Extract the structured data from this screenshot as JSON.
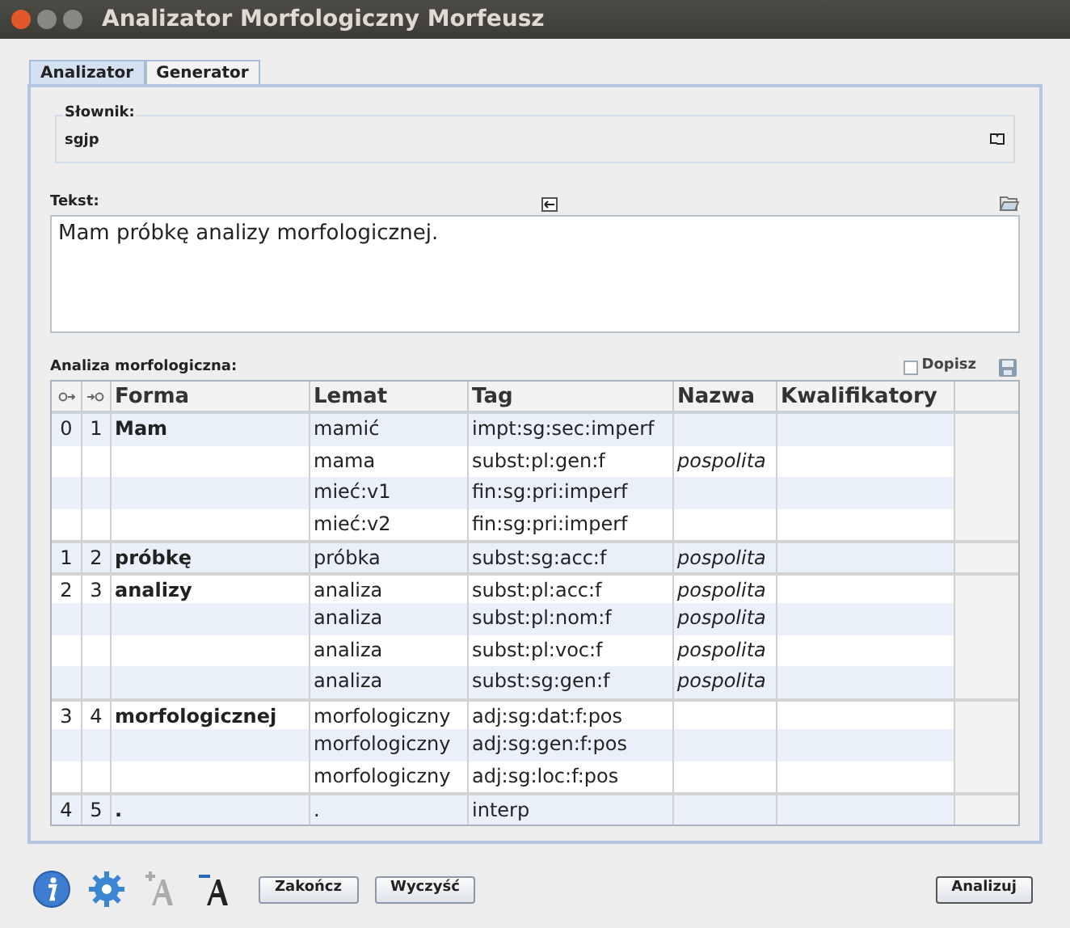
{
  "window": {
    "title": "Analizator Morfologiczny Morfeusz"
  },
  "tabs": [
    {
      "label": "Analizator",
      "selected": true
    },
    {
      "label": "Generator",
      "selected": false
    }
  ],
  "dictionary": {
    "label": "Słownik:",
    "value": "sgjp"
  },
  "text": {
    "label": "Tekst:",
    "value": "Mam próbkę analizy morfologicznej."
  },
  "analysis": {
    "label": "Analiza morfologiczna:",
    "append": {
      "label": "Dopisz",
      "checked": false
    },
    "table": {
      "columns": [
        "Forma",
        "Lemat",
        "Tag",
        "Nazwa",
        "Kwalifikatory"
      ],
      "rows": [
        {
          "start": "0",
          "end": "1",
          "form": "Mam",
          "lemma": "mamić",
          "tag": "impt:sg:sec:imperf"
        },
        {
          "lemma": "mama",
          "tag": "subst:pl:gen:f",
          "name": "pospolita"
        },
        {
          "lemma": "mieć:v1",
          "tag": "fin:sg:pri:imperf"
        },
        {
          "lemma": "mieć:v2",
          "tag": "fin:sg:pri:imperf"
        },
        {
          "start": "1",
          "end": "2",
          "form": "próbkę",
          "lemma": "próbka",
          "tag": "subst:sg:acc:f",
          "name": "pospolita"
        },
        {
          "start": "2",
          "end": "3",
          "form": "analizy",
          "lemma": "analiza",
          "tag": "subst:pl:acc:f",
          "name": "pospolita"
        },
        {
          "lemma": "analiza",
          "tag": "subst:pl:nom:f",
          "name": "pospolita"
        },
        {
          "lemma": "analiza",
          "tag": "subst:pl:voc:f",
          "name": "pospolita"
        },
        {
          "lemma": "analiza",
          "tag": "subst:sg:gen:f",
          "name": "pospolita"
        },
        {
          "start": "3",
          "end": "4",
          "form": "morfologicznej",
          "lemma": "morfologiczny",
          "tag": "adj:sg:dat:f:pos"
        },
        {
          "lemma": "morfologiczny",
          "tag": "adj:sg:gen:f:pos"
        },
        {
          "lemma": "morfologiczny",
          "tag": "adj:sg:loc:f:pos"
        },
        {
          "start": "4",
          "end": "5",
          "form": ".",
          "lemma": ".",
          "tag": "interp"
        }
      ]
    }
  },
  "toolbar": [
    {
      "kind": "info",
      "disabled": false
    },
    {
      "kind": "settings",
      "disabled": false
    },
    {
      "kind": "font-increase",
      "disabled": true
    },
    {
      "kind": "font-decrease",
      "disabled": false
    }
  ],
  "buttons": [
    {
      "label": "Zakończ"
    },
    {
      "label": "Wyczyść"
    }
  ],
  "primary_button": {
    "label": "Analizuj"
  }
}
